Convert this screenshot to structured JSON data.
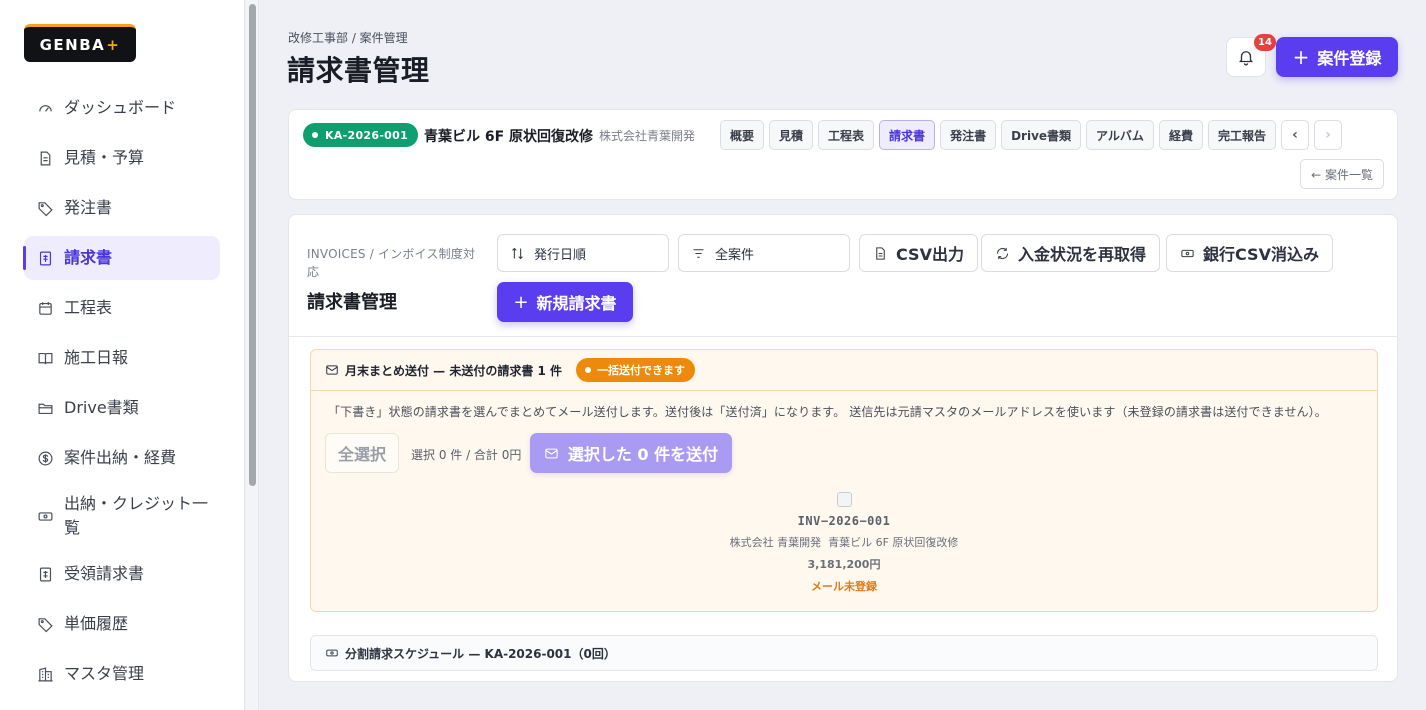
{
  "app": {
    "logo_text": "GENBA",
    "logo_accent": "+"
  },
  "sidebar": {
    "items": [
      {
        "label": "ダッシュボード",
        "icon": "gauge-icon"
      },
      {
        "label": "見積・予算",
        "icon": "document-icon"
      },
      {
        "label": "発注書",
        "icon": "tag-icon"
      },
      {
        "label": "請求書",
        "icon": "invoice-icon",
        "active": true
      },
      {
        "label": "工程表",
        "icon": "calendar-icon"
      },
      {
        "label": "施工日報",
        "icon": "book-icon"
      },
      {
        "label": "Drive書類",
        "icon": "folder-icon"
      },
      {
        "label": "案件出納・経費",
        "icon": "dollar-circle-icon"
      },
      {
        "label": "出納・クレジット一覧",
        "icon": "banknote-icon"
      },
      {
        "label": "受領請求書",
        "icon": "receipt-icon"
      },
      {
        "label": "単価履歴",
        "icon": "tag-icon"
      },
      {
        "label": "マスタ管理",
        "icon": "building-icon"
      }
    ]
  },
  "header": {
    "breadcrumb": "改修工事部 / 案件管理",
    "title": "請求書管理",
    "notification_count": "14",
    "new_project_label": "案件登録"
  },
  "project": {
    "code": "KA-2026-001",
    "name": "青葉ビル 6F 原状回復改修",
    "client": "株式会社青葉開発",
    "tabs": [
      "概要",
      "見積",
      "工程表",
      "請求書",
      "発注書",
      "Drive書類",
      "アルバム",
      "経費",
      "完工報告"
    ],
    "active_tab": "請求書",
    "prev_label": "‹",
    "next_label": "›",
    "back_label": "← 案件一覧"
  },
  "invoices": {
    "subtitle": "INVOICES / インボイス制度対応",
    "title": "請求書管理",
    "sort_label": "発行日順",
    "filter_label": "全案件",
    "csv_export_label": "CSV出力",
    "refresh_payment_label": "入金状況を再取得",
    "bank_csv_label": "銀行CSV消込み",
    "new_invoice_label": "新規請求書"
  },
  "batch_send": {
    "heading": "月末まとめ送付 — 未送付の請求書 1 件",
    "pill": "一括送付できます",
    "description": "「下書き」状態の請求書を選んでまとめてメール送付します。送付後は「送付済」になります。 送信先は元請マスタのメールアドレスを使います（未登録の請求書は送付できません）。",
    "select_all_label": "全選択",
    "selection_summary": "選択 0 件 / 合計 0円",
    "send_label": "選択した 0 件を送付",
    "item": {
      "number": "INV−2026−001",
      "client": "株式会社 青葉開発",
      "project": "青葉ビル 6F 原状回復改修",
      "amount": "3,181,200円",
      "warning": "メール未登録"
    }
  },
  "schedule": {
    "label": "分割請求スケジュール — KA-2026-001（0回）"
  },
  "colors": {
    "primary": "#5b3df0",
    "success": "#0f9f6e",
    "warning": "#ee8a0b",
    "danger": "#ea3f3f"
  }
}
